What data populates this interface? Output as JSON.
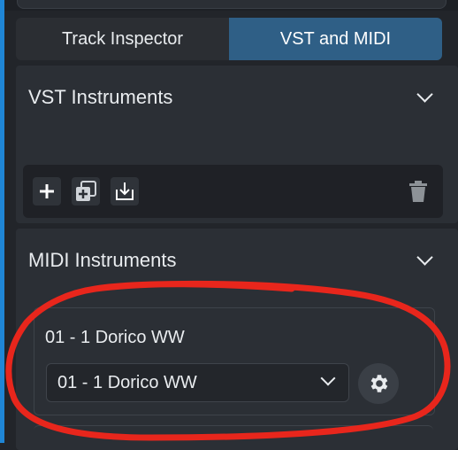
{
  "tabs": [
    {
      "label": "Track Inspector",
      "active": false
    },
    {
      "label": "VST and MIDI",
      "active": true
    }
  ],
  "vst_panel": {
    "title": "VST Instruments",
    "toolbar": {
      "icons": [
        "add-icon",
        "duplicate-icon",
        "import-icon",
        "trash-icon"
      ]
    }
  },
  "midi_panel": {
    "title": "MIDI Instruments",
    "instrument": {
      "name": "01 - 1 Dorico WW",
      "selected_port": "01 - 1 Dorico WW",
      "settings_icon": "gear-icon"
    }
  },
  "colors": {
    "accent_tab": "#2f5f86",
    "annotation": "#e8261c",
    "background": "#22252a"
  }
}
